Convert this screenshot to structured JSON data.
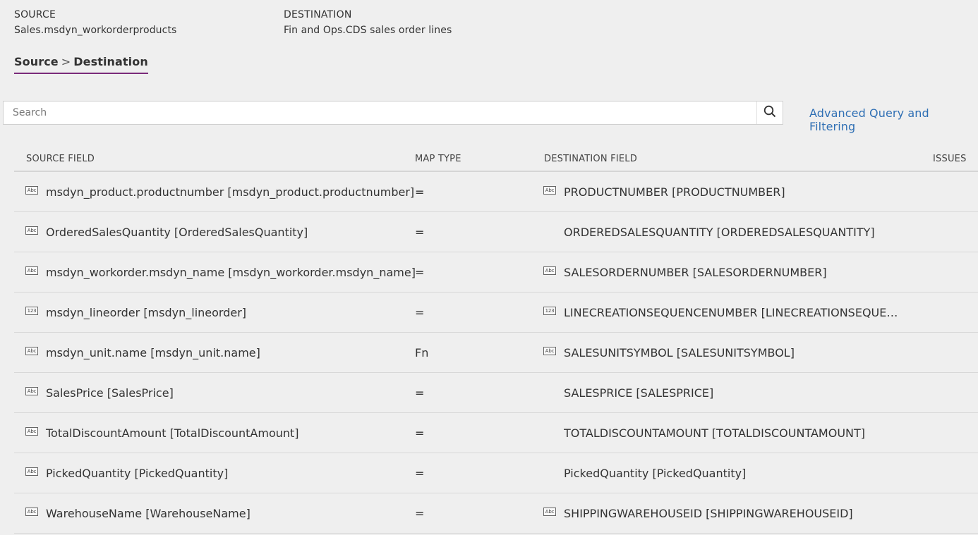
{
  "source": {
    "label": "SOURCE",
    "value": "Sales.msdyn_workorderproducts"
  },
  "destination": {
    "label": "DESTINATION",
    "value": "Fin and Ops.CDS sales order lines"
  },
  "tab": {
    "left": "Source",
    "separator": ">",
    "right": "Destination"
  },
  "search": {
    "placeholder": "Search"
  },
  "advanced_link": "Advanced Query and Filtering",
  "columns": {
    "source_field": "SOURCE FIELD",
    "map_type": "MAP TYPE",
    "destination_field": "DESTINATION FIELD",
    "issues": "ISSUES"
  },
  "icons": {
    "text": "Abc",
    "number": "123"
  },
  "rows": [
    {
      "src_icon": "text-type-icon",
      "src": "msdyn_product.productnumber [msdyn_product.productnumber]",
      "map": "=",
      "dst_icon": "text-type-icon",
      "dst": "PRODUCTNUMBER [PRODUCTNUMBER]"
    },
    {
      "src_icon": "text-type-icon",
      "src": "OrderedSalesQuantity [OrderedSalesQuantity]",
      "map": "=",
      "dst_icon": "",
      "dst": "ORDEREDSALESQUANTITY [ORDEREDSALESQUANTITY]"
    },
    {
      "src_icon": "text-type-icon",
      "src": "msdyn_workorder.msdyn_name [msdyn_workorder.msdyn_name]",
      "map": "=",
      "dst_icon": "text-type-icon",
      "dst": "SALESORDERNUMBER [SALESORDERNUMBER]"
    },
    {
      "src_icon": "number-type-icon",
      "src": "msdyn_lineorder [msdyn_lineorder]",
      "map": "=",
      "dst_icon": "number-type-icon",
      "dst": "LINECREATIONSEQUENCENUMBER [LINECREATIONSEQUENCE…"
    },
    {
      "src_icon": "text-type-icon",
      "src": "msdyn_unit.name [msdyn_unit.name]",
      "map": "Fn",
      "dst_icon": "text-type-icon",
      "dst": "SALESUNITSYMBOL [SALESUNITSYMBOL]"
    },
    {
      "src_icon": "text-type-icon",
      "src": "SalesPrice [SalesPrice]",
      "map": "=",
      "dst_icon": "",
      "dst": "SALESPRICE [SALESPRICE]"
    },
    {
      "src_icon": "text-type-icon",
      "src": "TotalDiscountAmount [TotalDiscountAmount]",
      "map": "=",
      "dst_icon": "",
      "dst": "TOTALDISCOUNTAMOUNT [TOTALDISCOUNTAMOUNT]"
    },
    {
      "src_icon": "text-type-icon",
      "src": "PickedQuantity [PickedQuantity]",
      "map": "=",
      "dst_icon": "",
      "dst": "PickedQuantity [PickedQuantity]"
    },
    {
      "src_icon": "text-type-icon",
      "src": "WarehouseName [WarehouseName]",
      "map": "=",
      "dst_icon": "text-type-icon",
      "dst": "SHIPPINGWAREHOUSEID [SHIPPINGWAREHOUSEID]"
    }
  ],
  "colors": {
    "background": "#efefef",
    "link": "#2f6fb4",
    "tab_underline": "#7a2a7a"
  }
}
